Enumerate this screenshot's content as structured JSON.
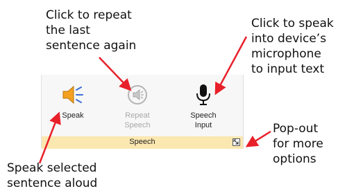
{
  "callouts": {
    "repeat": "Click to repeat\nthe last\nsentence again",
    "speech_input": "Click to speak\ninto device’s\nmicrophone\nto input text",
    "popout": "Pop-out\nfor more\noptions",
    "speak": "Speak selected\nsentence aloud"
  },
  "ribbon": {
    "group_label": "Speech",
    "buttons": [
      {
        "label": "Speak",
        "icon": "speaker-icon",
        "enabled": true
      },
      {
        "label": "Repeat\nSpeech",
        "icon": "repeat-speaker-icon",
        "enabled": false
      },
      {
        "label": "Speech\nInput",
        "icon": "microphone-icon",
        "enabled": true
      }
    ],
    "launcher_icon": "dialog-launcher-icon"
  },
  "colors": {
    "arrow": "#e8202a",
    "ribbon_footer": "#fbe7b0",
    "ribbon_bg": "#f7f7f7",
    "speaker_orange": "#f4a020",
    "speaker_waves": "#3a6fd8",
    "disabled_gray": "#a8a8a8"
  }
}
